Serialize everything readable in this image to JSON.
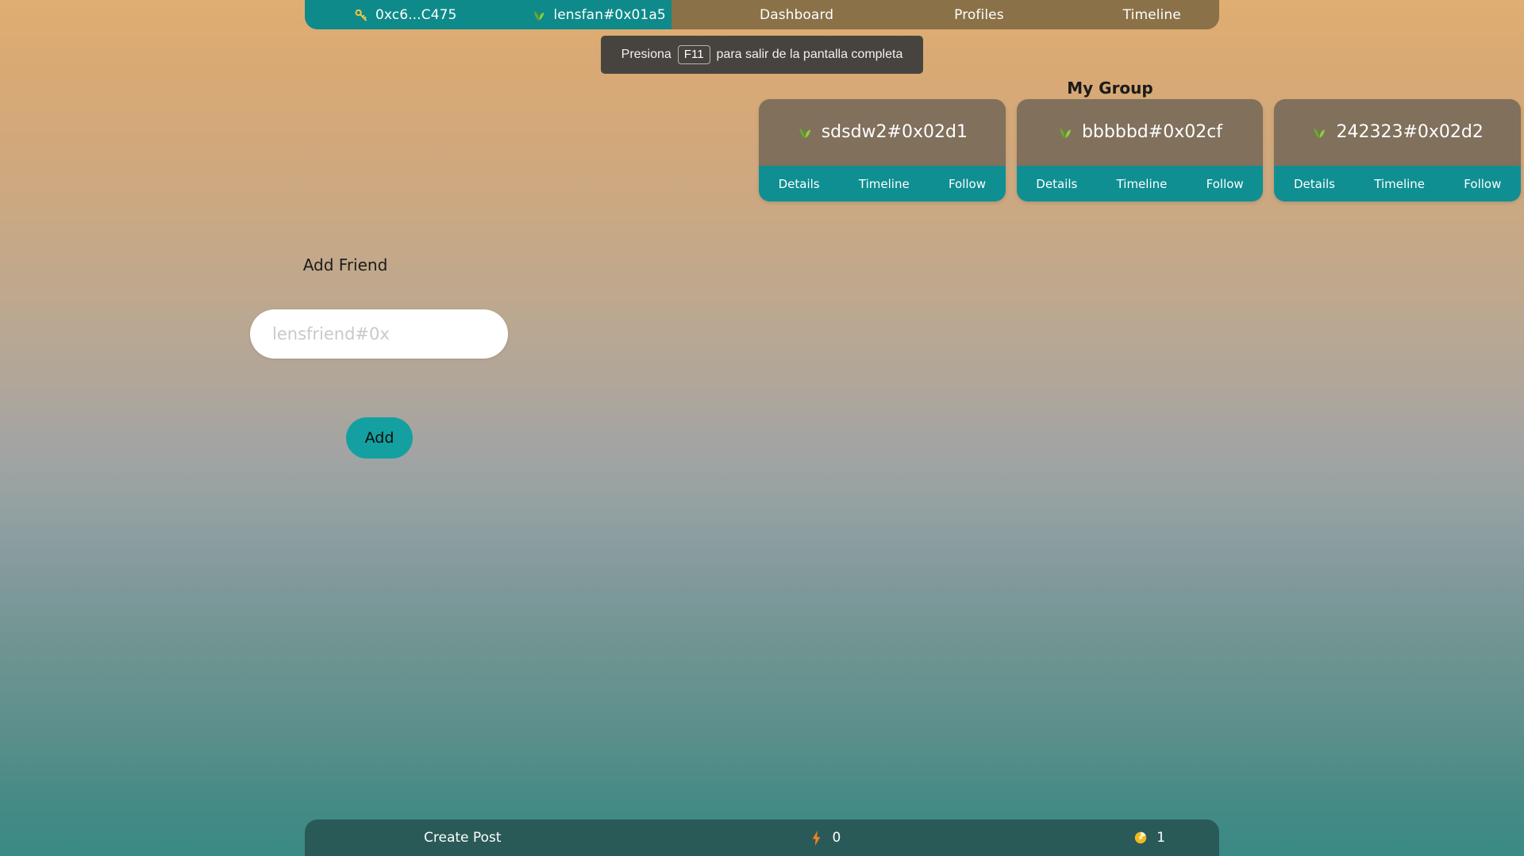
{
  "nav": {
    "wallet": {
      "icon": "key-icon",
      "label": "0xc6...C475"
    },
    "user": {
      "icon": "seedling-icon",
      "label": "lensfan#0x01a5"
    },
    "items": [
      {
        "label": "Dashboard"
      },
      {
        "label": "Profiles"
      },
      {
        "label": "Timeline"
      }
    ]
  },
  "toast": {
    "prefix": "Presiona",
    "key": "F11",
    "suffix": "para salir de la pantalla completa"
  },
  "group": {
    "title": "My Group",
    "cards": [
      {
        "icon": "seedling-icon",
        "name": "sdsdw2#0x02d1",
        "actions": [
          {
            "label": "Details"
          },
          {
            "label": "Timeline"
          },
          {
            "label": "Follow"
          }
        ]
      },
      {
        "icon": "seedling-icon",
        "name": "bbbbbd#0x02cf",
        "actions": [
          {
            "label": "Details"
          },
          {
            "label": "Timeline"
          },
          {
            "label": "Follow"
          }
        ]
      },
      {
        "icon": "seedling-icon",
        "name": "242323#0x02d2",
        "actions": [
          {
            "label": "Details"
          },
          {
            "label": "Timeline"
          },
          {
            "label": "Follow"
          }
        ]
      }
    ]
  },
  "add_friend": {
    "label": "Add Friend",
    "placeholder": "lensfriend#0x",
    "value": "",
    "button_label": "Add"
  },
  "bottom_bar": {
    "create_post_label": "Create Post",
    "energy": {
      "icon": "lightning-bolt-icon",
      "value": "0"
    },
    "coin": {
      "icon": "coin-icon",
      "value": "1"
    }
  },
  "colors": {
    "teal": "#0f8a8a",
    "nav_brown": "#8a7148",
    "card_brown": "#80705c",
    "card_action_teal": "#0f8f92",
    "bottom_bar": "#2a5a58",
    "toast_bg": "#474440",
    "key_gold": "#f2c744",
    "seedling_green": "#7fc243",
    "bolt_orange": "#f2821e",
    "coin_gold": "#f2b81e",
    "bg_top": "#e0ae72",
    "bg_bottom": "#3a8a85"
  }
}
